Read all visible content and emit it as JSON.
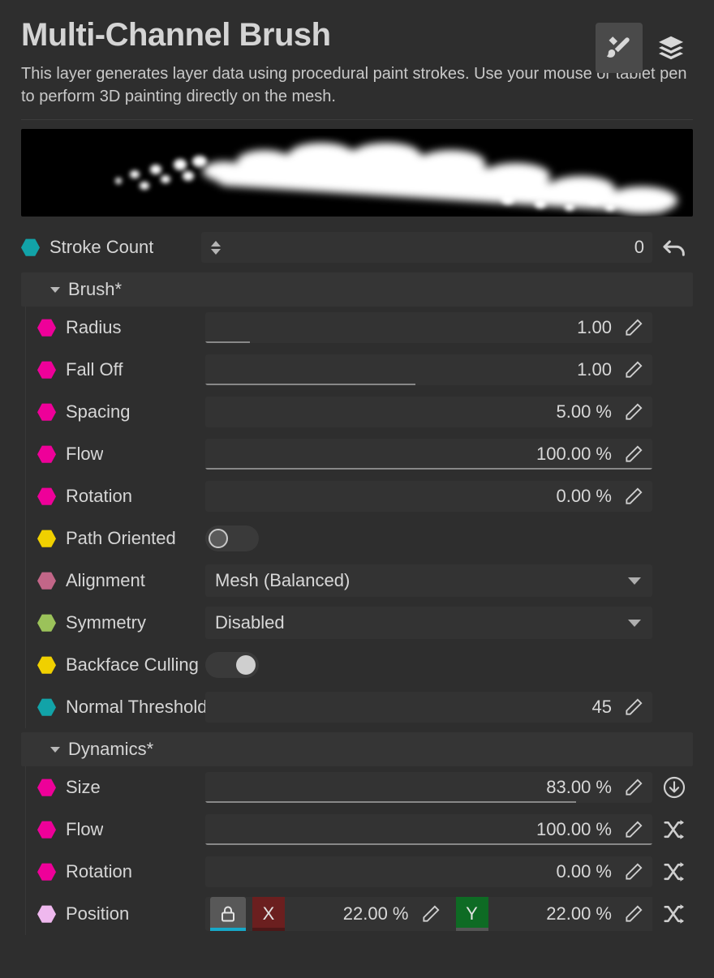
{
  "header": {
    "title": "Multi-Channel Brush",
    "description": "This layer generates layer data using procedural paint strokes. Use your mouse or tablet pen to perform 3D painting directly on the mesh.",
    "icons": [
      {
        "name": "brush-tool-icon",
        "active": true
      },
      {
        "name": "layers-icon",
        "active": false
      }
    ]
  },
  "preview": {
    "name": "brush-stroke-preview"
  },
  "stroke_count": {
    "label": "Stroke Count",
    "value": "0",
    "dot_color": "#12a3a8",
    "revert_icon": "undo-icon"
  },
  "groups": [
    {
      "title": "Brush*",
      "rows": [
        {
          "label": "Radius",
          "type": "slider",
          "value": "1.00",
          "fill": 10,
          "dot_color": "#ee0099"
        },
        {
          "label": "Fall Off",
          "type": "slider",
          "value": "1.00",
          "fill": 47,
          "dot_color": "#ee0099"
        },
        {
          "label": "Spacing",
          "type": "slider",
          "value": "5.00 %",
          "fill": 0,
          "dot_color": "#ee0099"
        },
        {
          "label": "Flow",
          "type": "slider",
          "value": "100.00 %",
          "fill": 100,
          "dot_color": "#ee0099"
        },
        {
          "label": "Rotation",
          "type": "slider",
          "value": "0.00 %",
          "fill": 0,
          "dot_color": "#ee0099"
        },
        {
          "label": "Path Oriented",
          "type": "toggle",
          "value": "off",
          "dot_color": "#f0d000"
        },
        {
          "label": "Alignment",
          "type": "select",
          "value": "Mesh (Balanced)",
          "dot_color": "#c26688"
        },
        {
          "label": "Symmetry",
          "type": "select",
          "value": "Disabled",
          "dot_color": "#9bc25a"
        },
        {
          "label": "Backface Culling",
          "type": "toggle",
          "value": "on",
          "dot_color": "#f0d000"
        },
        {
          "label": "Normal Threshold",
          "type": "slider",
          "value": "45",
          "fill": 0,
          "dot_color": "#12a3a8"
        }
      ]
    },
    {
      "title": "Dynamics*",
      "rows": [
        {
          "label": "Size",
          "type": "slider",
          "value": "83.00 %",
          "fill": 83,
          "dot_color": "#ee0099",
          "trailing_icon": "download-circle-icon"
        },
        {
          "label": "Flow",
          "type": "slider",
          "value": "100.00 %",
          "fill": 100,
          "dot_color": "#ee0099",
          "trailing_icon": "shuffle-icon"
        },
        {
          "label": "Rotation",
          "type": "slider",
          "value": "0.00 %",
          "fill": 0,
          "dot_color": "#ee0099",
          "trailing_icon": "shuffle-icon"
        },
        {
          "label": "Position",
          "type": "position",
          "dot_color": "#efb8ee",
          "trailing_icon": "shuffle-icon",
          "lock_icon": "lock-icon",
          "axes": [
            {
              "axis": "X",
              "value": "22.00 %"
            },
            {
              "axis": "Y",
              "value": "22.00 %"
            }
          ]
        }
      ]
    }
  ],
  "colors": {
    "background": "#2e2e2e",
    "field": "#333333",
    "group_header": "#353535",
    "text": "#d6d6d6",
    "lock_underline": "#17a8c8",
    "x_axis": "#6b1f1f",
    "y_axis": "#0e6b24"
  }
}
